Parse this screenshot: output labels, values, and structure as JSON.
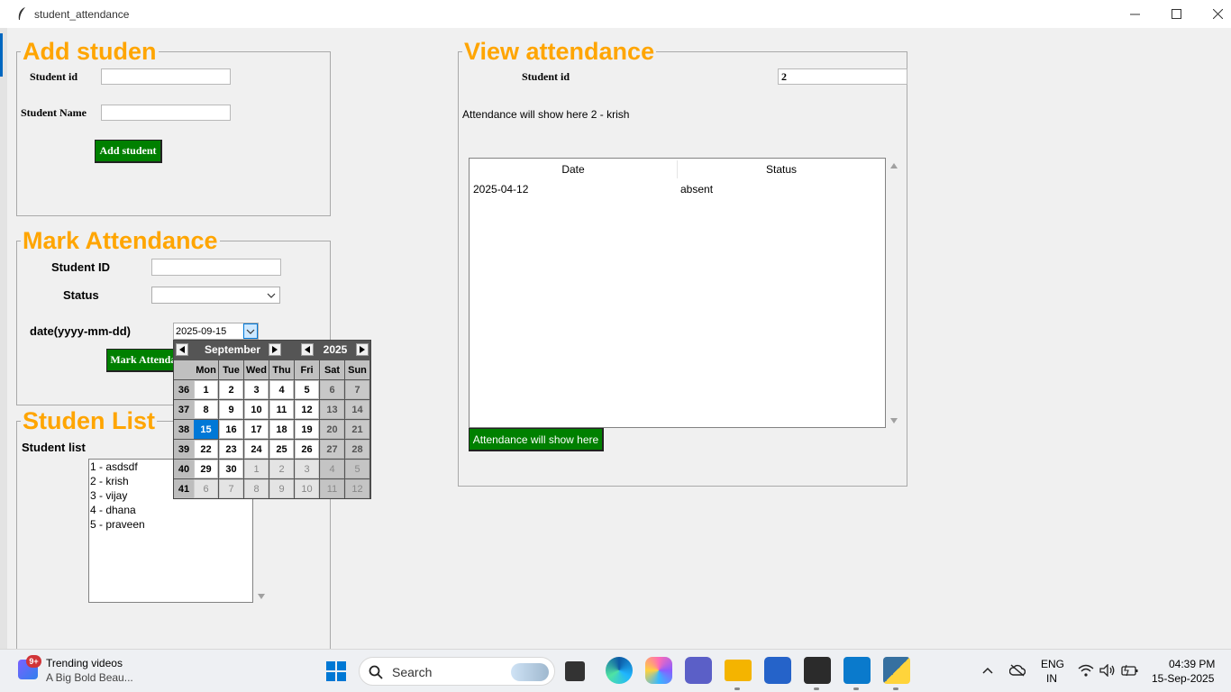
{
  "window": {
    "title": "student_attendance"
  },
  "add_student": {
    "legend": "Add studen",
    "student_id_label": "Student id",
    "student_id_value": "",
    "student_name_label": "Student Name",
    "student_name_value": "",
    "button": "Add student"
  },
  "mark_attendance": {
    "legend": "Mark Attendance",
    "student_id_label": "Student ID",
    "student_id_value": "",
    "status_label": "Status",
    "status_value": "",
    "date_label": "date(yyyy-mm-dd)",
    "date_value": "2025-09-15",
    "button": "Mark Attendance"
  },
  "calendar": {
    "month": "September",
    "year": "2025",
    "day_headers": [
      "Mon",
      "Tue",
      "Wed",
      "Thu",
      "Fri",
      "Sat",
      "Sun"
    ],
    "weeks": [
      {
        "wk": "36",
        "days": [
          "1",
          "2",
          "3",
          "4",
          "5",
          "6",
          "7"
        ]
      },
      {
        "wk": "37",
        "days": [
          "8",
          "9",
          "10",
          "11",
          "12",
          "13",
          "14"
        ]
      },
      {
        "wk": "38",
        "days": [
          "15",
          "16",
          "17",
          "18",
          "19",
          "20",
          "21"
        ]
      },
      {
        "wk": "39",
        "days": [
          "22",
          "23",
          "24",
          "25",
          "26",
          "27",
          "28"
        ]
      },
      {
        "wk": "40",
        "days": [
          "29",
          "30",
          "1",
          "2",
          "3",
          "4",
          "5"
        ]
      },
      {
        "wk": "41",
        "days": [
          "6",
          "7",
          "8",
          "9",
          "10",
          "11",
          "12"
        ]
      }
    ],
    "selected_day": "15"
  },
  "student_list": {
    "legend": "Studen List",
    "label": "Student list",
    "items": [
      "1 - asdsdf",
      "2 - krish",
      "3 - vijay",
      "4 - dhana",
      "5 - praveen"
    ]
  },
  "view_attendance": {
    "legend": "View attendance",
    "student_id_label": "Student id",
    "student_id_value": "2",
    "info_text": "Attendance will show here  2 - krish",
    "columns": [
      "Date",
      "Status"
    ],
    "rows": [
      {
        "date": "2025-04-12",
        "status": "absent"
      }
    ],
    "button": "Attendance will show here"
  },
  "taskbar": {
    "notification_badge": "9+",
    "widget_title": "Trending videos",
    "widget_subtitle": "A Big Bold Beau...",
    "search_placeholder": "Search",
    "lang_top": "ENG",
    "lang_bottom": "IN",
    "time": "04:39 PM",
    "date": "15-Sep-2025"
  },
  "colors": {
    "legend": "#ffa500",
    "button": "#008000",
    "selection": "#0078d7"
  }
}
